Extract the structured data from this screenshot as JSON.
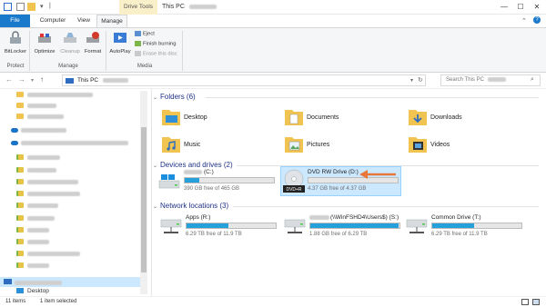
{
  "titlebar": {
    "drive_tools": "Drive Tools",
    "title": "This PC",
    "minimize": "—",
    "maximize": "☐",
    "close": "✕"
  },
  "ribbon_tabs": {
    "file": "File",
    "computer": "Computer",
    "view": "View",
    "manage": "Manage"
  },
  "ribbon": {
    "bitlocker": "BitLocker",
    "optimize": "Optimize",
    "cleanup": "Cleanup",
    "format": "Format",
    "autoplay": "AutoPlay",
    "eject": "Eject",
    "finish_burning": "Finish burning",
    "erase_disc": "Erase this disc",
    "groups": {
      "protect": "Protect",
      "manage": "Manage",
      "media": "Media"
    }
  },
  "address": {
    "path": "This PC",
    "search_placeholder": "Search This PC"
  },
  "nav": {
    "desktop": "Desktop"
  },
  "sections": {
    "folders": "Folders (6)",
    "devices": "Devices and drives (2)",
    "network": "Network locations (3)"
  },
  "folders": [
    {
      "label": "Desktop"
    },
    {
      "label": "Documents"
    },
    {
      "label": "Downloads"
    },
    {
      "label": "Music"
    },
    {
      "label": "Pictures"
    },
    {
      "label": "Videos"
    }
  ],
  "drives": [
    {
      "name": "(C:)",
      "free": "390 GB free of 465 GB",
      "used_fraction": 0.16
    },
    {
      "name": "DVD RW Drive (D:)",
      "free": "4.37 GB free of 4.37 GB",
      "used_fraction": 0.0
    }
  ],
  "network": [
    {
      "name": "Apps (R:)",
      "free": "6.29 TB free of 11.9 TB",
      "used_fraction": 0.47
    },
    {
      "name": "(\\\\WinFSHD4\\Users$) (S:)",
      "free": "1.88 GB free of 6.29 TB",
      "used_fraction": 0.99
    },
    {
      "name": "Common Drive (T:)",
      "free": "6.29 TB free of 11.9 TB",
      "used_fraction": 0.47
    }
  ],
  "status": {
    "items": "11 items",
    "selected": "1 item selected"
  },
  "colors": {
    "accent": "#1979ca",
    "drive_bar": "#26a0da",
    "selection": "#cce8ff",
    "arrow": "#e8773a"
  }
}
